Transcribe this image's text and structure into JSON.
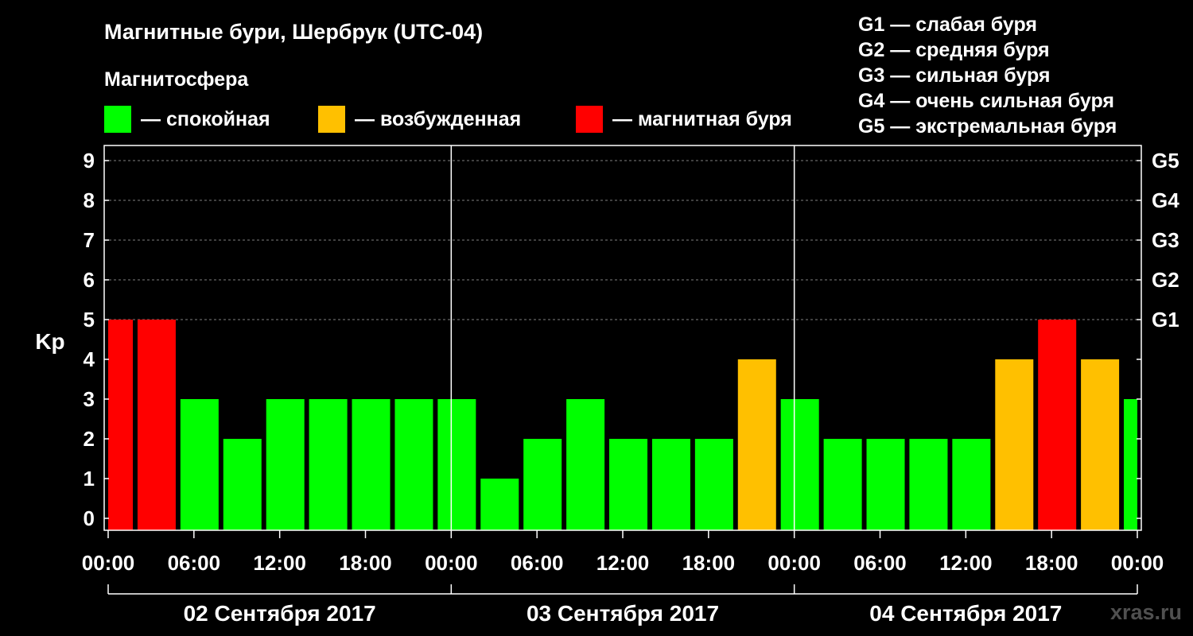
{
  "header": {
    "title": "Магнитные бури, Шербрук (UTC-04)",
    "magnetosphere_label": "Магнитосфера"
  },
  "legend": [
    {
      "label": "— спокойная",
      "color": "#00ff00"
    },
    {
      "label": "— возбужденная",
      "color": "#ffc000"
    },
    {
      "label": "— магнитная буря",
      "color": "#ff0000"
    }
  ],
  "g_scale": [
    "G1 — слабая буря",
    "G2 — средняя буря",
    "G3 — сильная буря",
    "G4 — очень сильная буря",
    "G5 — экстремальная буря"
  ],
  "watermark": "xras.ru",
  "chart_data": {
    "type": "bar",
    "ylabel": "Kp",
    "ylim": [
      0,
      9
    ],
    "yticks": [
      "0",
      "1",
      "2",
      "3",
      "4",
      "5",
      "6",
      "7",
      "8",
      "9"
    ],
    "right_axis_labels": [
      {
        "kp": 5,
        "label": "G1"
      },
      {
        "kp": 6,
        "label": "G2"
      },
      {
        "kp": 7,
        "label": "G3"
      },
      {
        "kp": 8,
        "label": "G4"
      },
      {
        "kp": 9,
        "label": "G5"
      }
    ],
    "grid": "dashed horizontal at 5-9",
    "xticks": [
      "00:00",
      "06:00",
      "12:00",
      "18:00",
      "00:00",
      "06:00",
      "12:00",
      "18:00",
      "00:00",
      "06:00",
      "12:00",
      "18:00",
      "00:00"
    ],
    "days": [
      "02 Сентября 2017",
      "03 Сентября 2017",
      "04 Сентября 2017"
    ],
    "bars": [
      {
        "start_hour": -1,
        "kp": 5,
        "level": "storm"
      },
      {
        "start_hour": 2,
        "kp": 5,
        "level": "storm"
      },
      {
        "start_hour": 5,
        "kp": 3,
        "level": "quiet"
      },
      {
        "start_hour": 8,
        "kp": 2,
        "level": "quiet"
      },
      {
        "start_hour": 11,
        "kp": 3,
        "level": "quiet"
      },
      {
        "start_hour": 14,
        "kp": 3,
        "level": "quiet"
      },
      {
        "start_hour": 17,
        "kp": 3,
        "level": "quiet"
      },
      {
        "start_hour": 20,
        "kp": 3,
        "level": "quiet"
      },
      {
        "start_hour": 23,
        "kp": 3,
        "level": "quiet"
      },
      {
        "start_hour": 26,
        "kp": 1,
        "level": "quiet"
      },
      {
        "start_hour": 29,
        "kp": 2,
        "level": "quiet"
      },
      {
        "start_hour": 32,
        "kp": 3,
        "level": "quiet"
      },
      {
        "start_hour": 35,
        "kp": 2,
        "level": "quiet"
      },
      {
        "start_hour": 38,
        "kp": 2,
        "level": "quiet"
      },
      {
        "start_hour": 41,
        "kp": 2,
        "level": "quiet"
      },
      {
        "start_hour": 44,
        "kp": 4,
        "level": "unsettled"
      },
      {
        "start_hour": 47,
        "kp": 3,
        "level": "quiet"
      },
      {
        "start_hour": 50,
        "kp": 2,
        "level": "quiet"
      },
      {
        "start_hour": 53,
        "kp": 2,
        "level": "quiet"
      },
      {
        "start_hour": 56,
        "kp": 2,
        "level": "quiet"
      },
      {
        "start_hour": 59,
        "kp": 2,
        "level": "quiet"
      },
      {
        "start_hour": 62,
        "kp": 4,
        "level": "unsettled"
      },
      {
        "start_hour": 65,
        "kp": 5,
        "level": "storm"
      },
      {
        "start_hour": 68,
        "kp": 4,
        "level": "unsettled"
      },
      {
        "start_hour": 71,
        "kp": 3,
        "level": "quiet"
      }
    ],
    "level_colors": {
      "quiet": "#00ff00",
      "unsettled": "#ffc000",
      "storm": "#ff0000"
    }
  }
}
